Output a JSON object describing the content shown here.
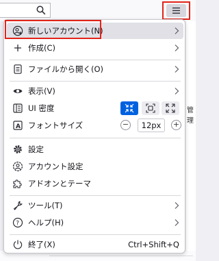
{
  "menu": {
    "new_account": "新しいアカウント(N)",
    "create": "作成(C)",
    "open_file": "ファイルから開く(O)",
    "view": "表示(V)",
    "ui_density": "UI 密度",
    "font_size": "フォントサイズ",
    "font_size_value": "12px",
    "font_minus": "−",
    "font_plus": "+",
    "settings": "設定",
    "account_settings": "アカウント設定",
    "addons": "アドオンとテーマ",
    "tools": "ツール(T)",
    "help": "ヘルプ(H)",
    "quit": "終了(X)",
    "quit_shortcut": "Ctrl+Shift+Q"
  },
  "background": {
    "partial_text": "管理"
  },
  "colors": {
    "accent": "#0061e0",
    "annotation": "#e2231a",
    "hover": "#e0e0e6"
  }
}
